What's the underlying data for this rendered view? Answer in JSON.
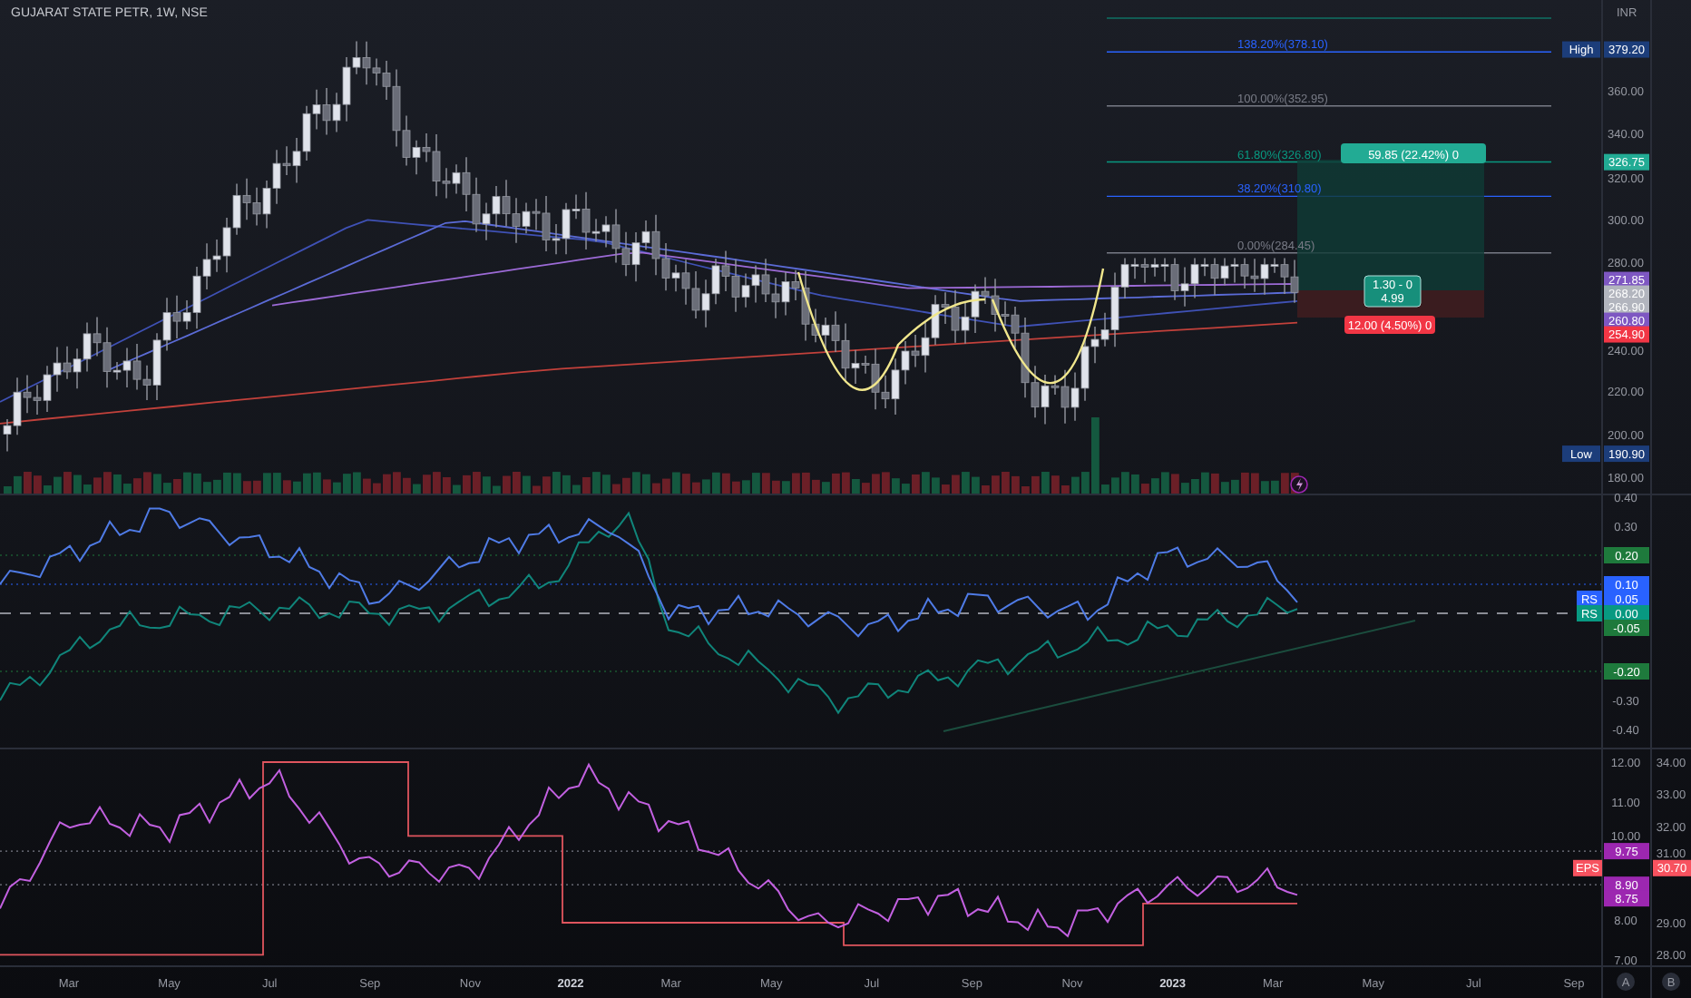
{
  "title": "GUJARAT STATE PETR, 1W, NSE",
  "currency": "INR",
  "main_pane": {
    "fib_levels": [
      {
        "label": "138.20%(378.10)",
        "color": "#2962ff"
      },
      {
        "label": "100.00%(352.95)",
        "color": "#787b86"
      },
      {
        "label": "61.80%(326.80)",
        "color": "#089981"
      },
      {
        "label": "38.20%(310.80)",
        "color": "#2962ff"
      },
      {
        "label": "0.00%(284.45)",
        "color": "#787b86"
      }
    ],
    "position": {
      "profit_label": "59.85 (22.42%) 0",
      "ratio_lines": [
        "1.30 - 0",
        "4.99"
      ],
      "loss_label": "12.00 (4.50%) 0"
    },
    "ticks": [
      "360.00",
      "340.00",
      "320.00",
      "300.00",
      "280.00",
      "240.00",
      "220.00",
      "200.00",
      "180.00"
    ],
    "badges": [
      {
        "value": "379.20",
        "color": "#1c3d7a",
        "tag": "High"
      },
      {
        "value": "326.75",
        "color": "#22ab94"
      },
      {
        "value": "271.85",
        "color": "#7e57c2"
      },
      {
        "value": "268.20",
        "color": "#b2b5be"
      },
      {
        "value": "266.90",
        "color": "#b2b5be"
      },
      {
        "value": "260.80",
        "color": "#7e57c2"
      },
      {
        "value": "254.90",
        "color": "#f23645"
      },
      {
        "value": "190.90",
        "color": "#1c3d7a",
        "tag": "Low"
      }
    ]
  },
  "strength_pane": {
    "ticks": [
      "0.40",
      "0.30",
      "-0.30",
      "-0.40"
    ],
    "badges": [
      {
        "value": "0.20",
        "color": "#1e7a3c"
      },
      {
        "value": "0.10",
        "color": "#2962ff"
      },
      {
        "value": "0.05",
        "color": "#2962ff",
        "tag": "RS"
      },
      {
        "value": "0.00",
        "color": "#089981",
        "tag": "RS"
      },
      {
        "value": "-0.05",
        "color": "#1e7a3c"
      },
      {
        "value": "-0.20",
        "color": "#1e7a3c"
      }
    ]
  },
  "eps_pane": {
    "ticks_a": [
      "12.00",
      "11.00",
      "10.00",
      "8.00",
      "7.00"
    ],
    "ticks_b": [
      "34.00",
      "33.00",
      "32.00",
      "31.00",
      "29.00",
      "28.00"
    ],
    "badges_a": [
      {
        "value": "9.75",
        "color": "#9c27b0"
      },
      {
        "value": "8.90",
        "color": "#9c27b0"
      },
      {
        "value": "8.75",
        "color": "#9c27b0"
      }
    ],
    "badges_b": [
      {
        "value": "30.70",
        "color": "#f7525f",
        "tag": "EPS"
      }
    ]
  },
  "time_axis": [
    {
      "label": "Mar",
      "kind": "month"
    },
    {
      "label": "May",
      "kind": "month"
    },
    {
      "label": "Jul",
      "kind": "month"
    },
    {
      "label": "Sep",
      "kind": "month"
    },
    {
      "label": "Nov",
      "kind": "month"
    },
    {
      "label": "2022",
      "kind": "year"
    },
    {
      "label": "Mar",
      "kind": "month"
    },
    {
      "label": "May",
      "kind": "month"
    },
    {
      "label": "Jul",
      "kind": "month"
    },
    {
      "label": "Sep",
      "kind": "month"
    },
    {
      "label": "Nov",
      "kind": "month"
    },
    {
      "label": "2023",
      "kind": "year"
    },
    {
      "label": "Mar",
      "kind": "month"
    },
    {
      "label": "May",
      "kind": "month"
    },
    {
      "label": "Jul",
      "kind": "month"
    },
    {
      "label": "Sep",
      "kind": "month"
    }
  ],
  "scale_buttons": [
    "A",
    "B"
  ]
}
